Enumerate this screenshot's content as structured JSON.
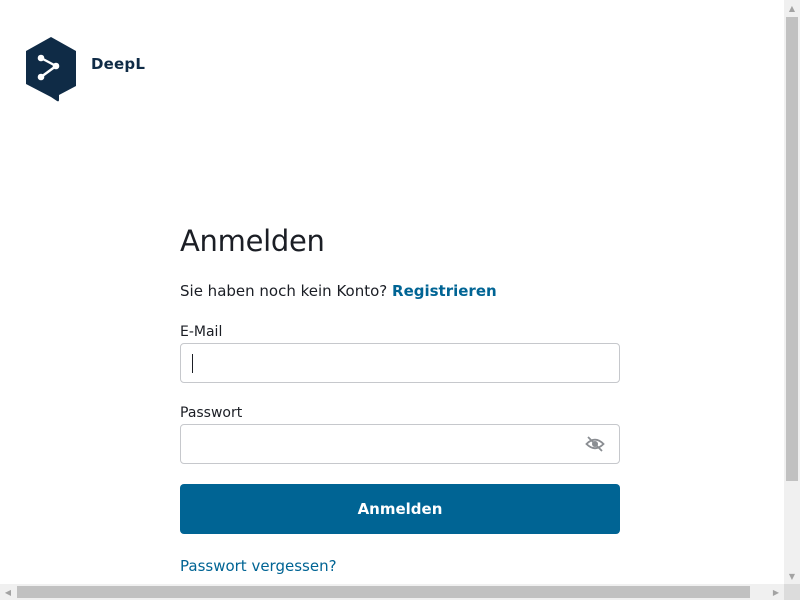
{
  "brand": {
    "name": "DeepL",
    "logo_color": "#0f2b46"
  },
  "login": {
    "title": "Anmelden",
    "signup_prompt": "Sie haben noch kein Konto?",
    "signup_link": "Registrieren",
    "email_label": "E-Mail",
    "email_value": "",
    "password_label": "Passwort",
    "password_value": "",
    "password_toggle_icon": "eye-slash-icon",
    "submit_label": "Anmelden",
    "forgot_link": "Passwort vergessen?"
  },
  "colors": {
    "accent": "#006494",
    "text": "#1b1e25",
    "border": "#c6c8cc"
  }
}
